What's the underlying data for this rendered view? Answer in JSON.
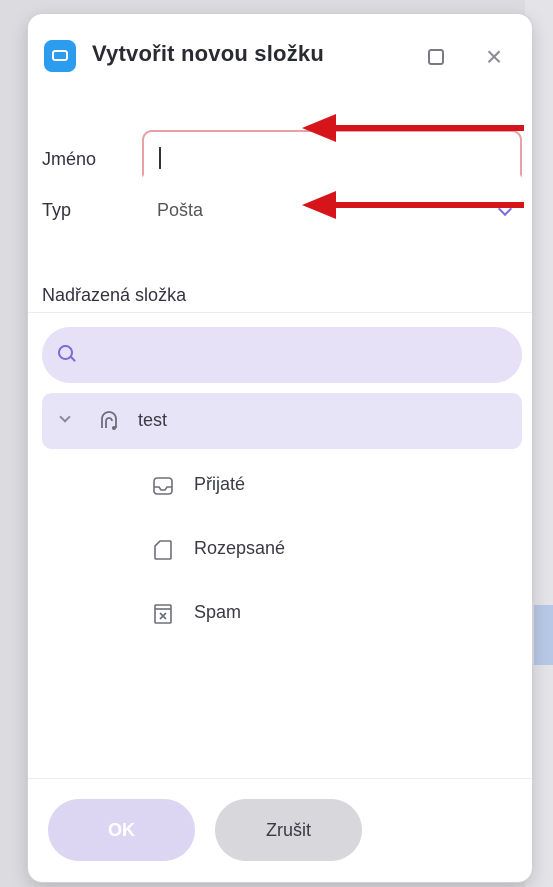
{
  "dialog": {
    "title": "Vytvořit novou složku",
    "app_icon": "folder-app-icon",
    "maximize_icon": "maximize-icon",
    "close_icon": "close-icon"
  },
  "form": {
    "name_label": "Jméno",
    "name_value": "",
    "type_label": "Typ",
    "type_value": "Pošta",
    "parent_label": "Nadřazená složka"
  },
  "search": {
    "placeholder": "",
    "icon": "search-icon"
  },
  "tree": {
    "account": {
      "label": "test",
      "icon": "account-icon",
      "expanded": true,
      "selected": true
    },
    "folders": [
      {
        "label": "Přijaté",
        "icon": "inbox-icon"
      },
      {
        "label": "Rozepsané",
        "icon": "drafts-icon"
      },
      {
        "label": "Spam",
        "icon": "spam-icon"
      }
    ]
  },
  "footer": {
    "ok_label": "OK",
    "cancel_label": "Zrušit"
  },
  "colors": {
    "accent": "#7b6cd8",
    "selected_row": "#e8e4f7",
    "search_bg": "#e6e1f7",
    "ok_disabled": "#ddd6f3",
    "cancel_bg": "#d8d8dc",
    "annotation_arrow": "#d6151b",
    "app_icon": "#2b9cf0"
  }
}
